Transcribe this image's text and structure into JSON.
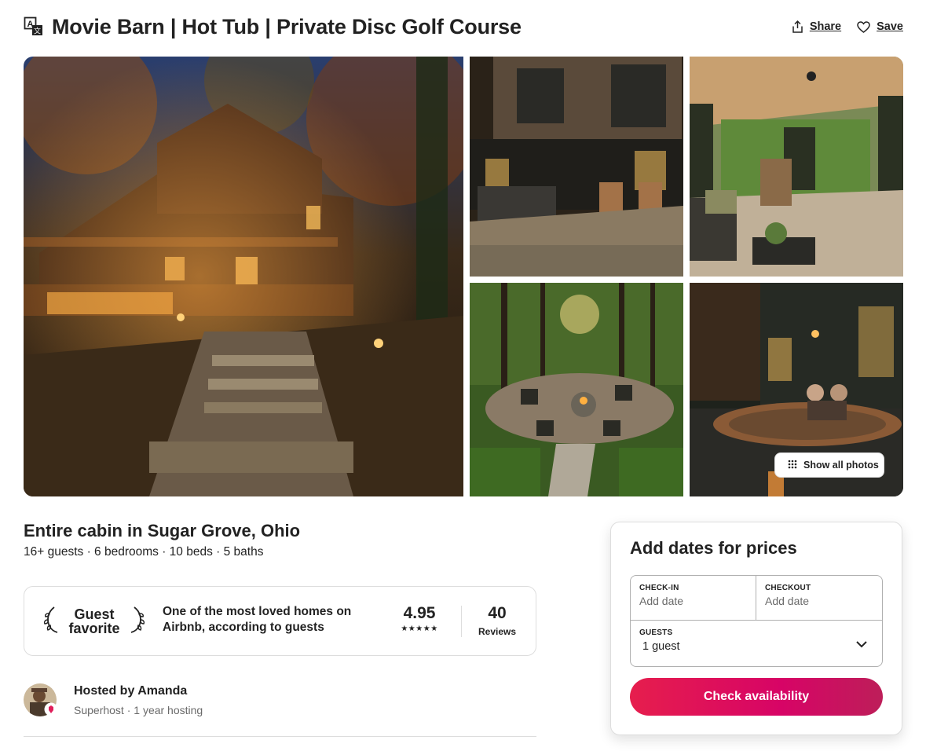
{
  "listing": {
    "title": "Movie Barn | Hot Tub | Private Disc Golf Course",
    "subtitle": "Entire cabin in Sugar Grove, Ohio",
    "summary": "16+ guests · 6 bedrooms · 10 beds · 5 baths"
  },
  "header": {
    "translate_icon": "translate-icon",
    "share_label": "Share",
    "share_icon": "share-icon",
    "save_label": "Save",
    "save_icon": "heart-icon"
  },
  "gallery": {
    "show_all_label": "Show all photos",
    "show_all_icon": "grid-dots-icon",
    "photos": [
      "cabin-exterior-night",
      "patio-hot-tub",
      "screened-porch",
      "fire-pit-woods",
      "hot-tub-couple"
    ]
  },
  "guest_favorite": {
    "badge_line1": "Guest",
    "badge_line2": "favorite",
    "description": "One of the most loved homes on Airbnb, according to guests",
    "rating": "4.95",
    "stars": "★★★★★",
    "reviews_count": "40",
    "reviews_label": "Reviews"
  },
  "host": {
    "name": "Hosted by Amanda",
    "meta": "Superhost · 1 year hosting"
  },
  "booking": {
    "title": "Add dates for prices",
    "checkin_label": "CHECK-IN",
    "checkin_value": "Add date",
    "checkout_label": "CHECKOUT",
    "checkout_value": "Add date",
    "guests_label": "GUESTS",
    "guests_value": "1 guest",
    "button_label": "Check availability",
    "button_color": "#e61e4d"
  }
}
